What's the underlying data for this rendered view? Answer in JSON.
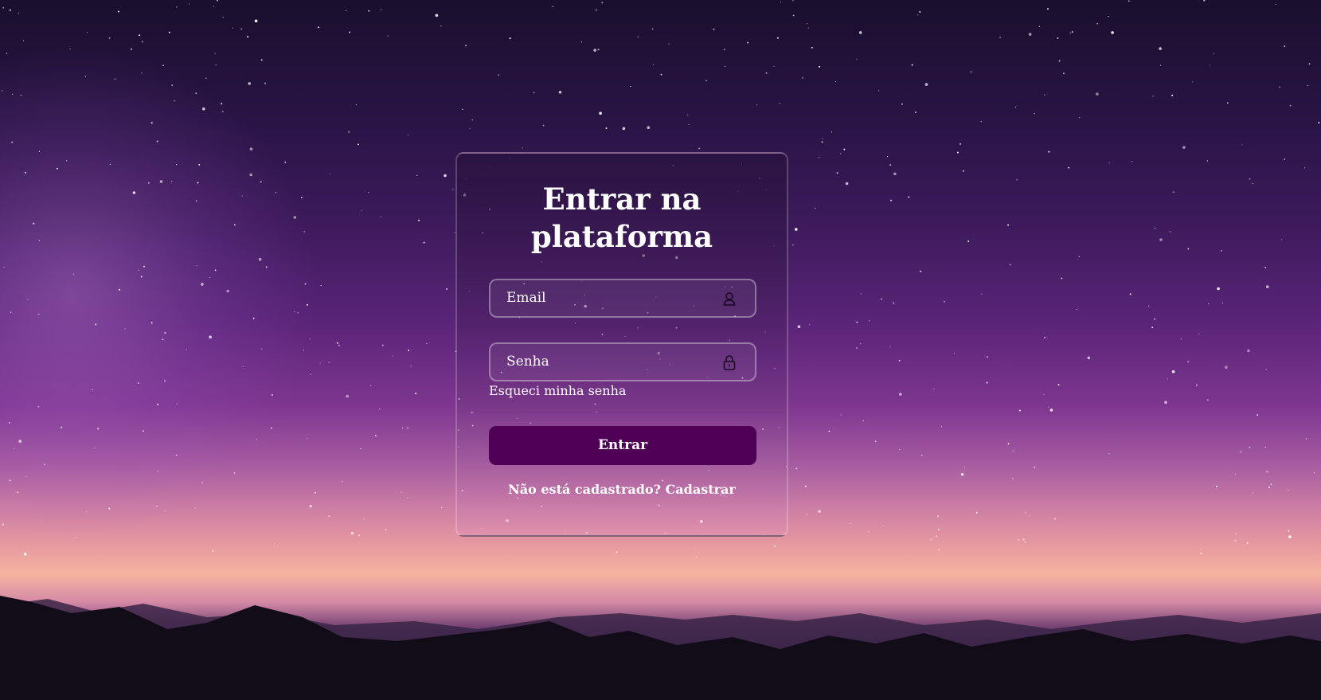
{
  "login": {
    "title_line1": "Entrar na",
    "title_line2": "plataforma",
    "email_placeholder": "Email",
    "password_placeholder": "Senha",
    "forgot_password": "Esqueci minha senha",
    "submit_label": "Entrar",
    "signup_prompt": "Não está cadastrado?",
    "signup_link": "Cadastrar"
  },
  "icons": {
    "email_field_icon": "user-icon",
    "password_field_icon": "lock-icon"
  },
  "colors": {
    "button_bg": "#4f0056",
    "text": "#ffffff"
  }
}
